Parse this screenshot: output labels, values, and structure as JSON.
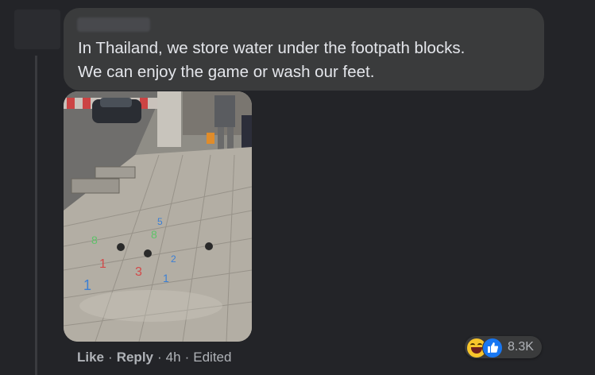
{
  "comment": {
    "lines": [
      "In Thailand, we store water under the footpath blocks.",
      "We can enjoy the game or wash our feet."
    ]
  },
  "actions": {
    "like": "Like",
    "dot1": "·",
    "reply": "Reply",
    "dot2": "·",
    "time": "4h",
    "dot3": "·",
    "edited": "Edited"
  },
  "reactions": {
    "icons": [
      "haha-icon",
      "like-icon"
    ],
    "count": "8.3K"
  },
  "colors": {
    "background": "#232428",
    "bubble": "#3a3b3c",
    "text": "#e4e6eb",
    "muted": "#b0b3b8",
    "like_blue": "#1877f2",
    "haha_yellow": "#f7c52b"
  }
}
